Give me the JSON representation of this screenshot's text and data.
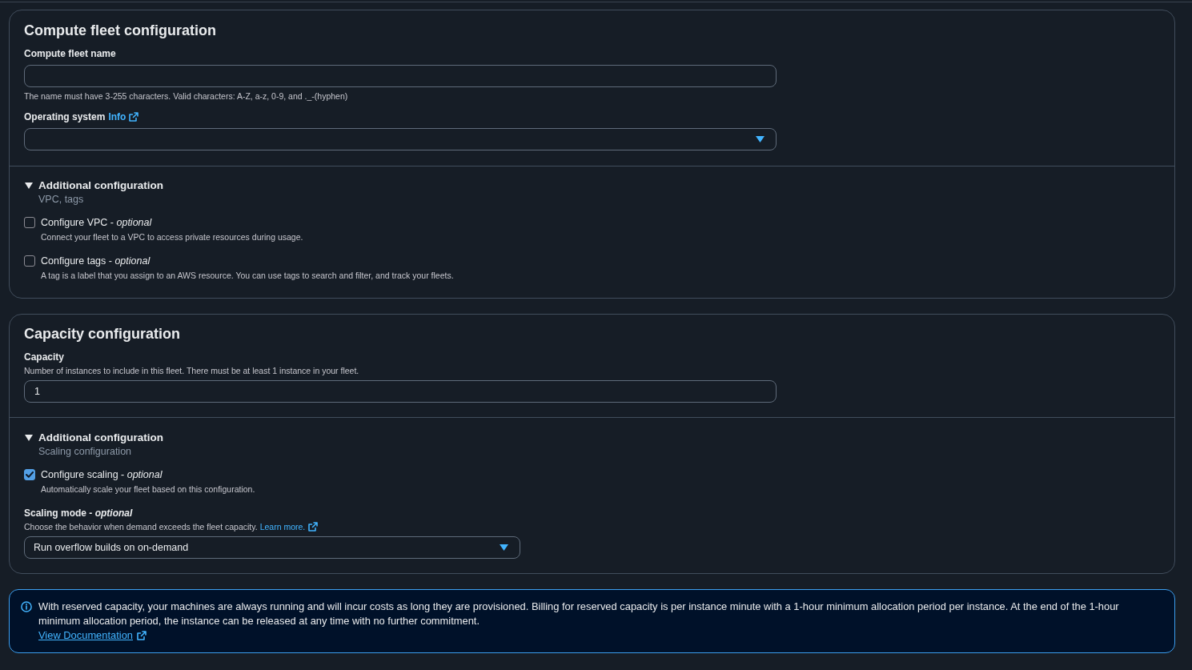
{
  "panels": [
    {
      "title": "Compute fleet configuration",
      "fields": [
        {
          "kind": "text",
          "label": "Compute fleet name",
          "hint": "The name must have 3-255 characters. Valid characters: A-Z, a-z, 0-9, and ._-(hyphen)"
        },
        {
          "kind": "select",
          "label": "Operating system",
          "info_link": "Info"
        }
      ],
      "additional": {
        "title": "Additional configuration",
        "subtitle": "VPC, tags",
        "expanded": true,
        "items": [
          {
            "kind": "checkbox",
            "label": "Configure VPC - *optional*",
            "description": "Connect your fleet to a VPC to access private resources during usage.",
            "checked": false
          },
          {
            "kind": "checkbox",
            "label": "Configure tags - *optional*",
            "description": "A tag is a label that you assign to an AWS resource. You can use tags to search and filter, and track your fleets.",
            "checked": false
          }
        ]
      }
    },
    {
      "title": "Capacity configuration",
      "fields": [
        {
          "kind": "text",
          "label": "Capacity",
          "description": "Number of instances to include in this fleet. There must be at least 1 instance in your fleet.",
          "value": "1"
        }
      ],
      "additional": {
        "title": "Additional configuration",
        "subtitle": "Scaling configuration",
        "expanded": true,
        "items": [
          {
            "kind": "checkbox",
            "label": "Configure scaling - *optional*",
            "description": "Automatically scale your fleet based on this configuration.",
            "checked": true
          },
          {
            "kind": "select",
            "label": "Scaling mode - *optional*",
            "description": "Choose the behavior when demand exceeds the fleet capacity.",
            "link": "Learn more.",
            "value": "Run overflow builds on on-demand"
          }
        ]
      }
    }
  ],
  "alert": {
    "message": "With reserved capacity, your machines are always running and will incur costs as long they are provisioned. Billing for reserved capacity is per instance minute with a 1-hour minimum allocation period per instance. At the end of the 1-hour minimum allocation period, the instance can be released at any time with no further commitment.",
    "link": "View Documentation"
  }
}
